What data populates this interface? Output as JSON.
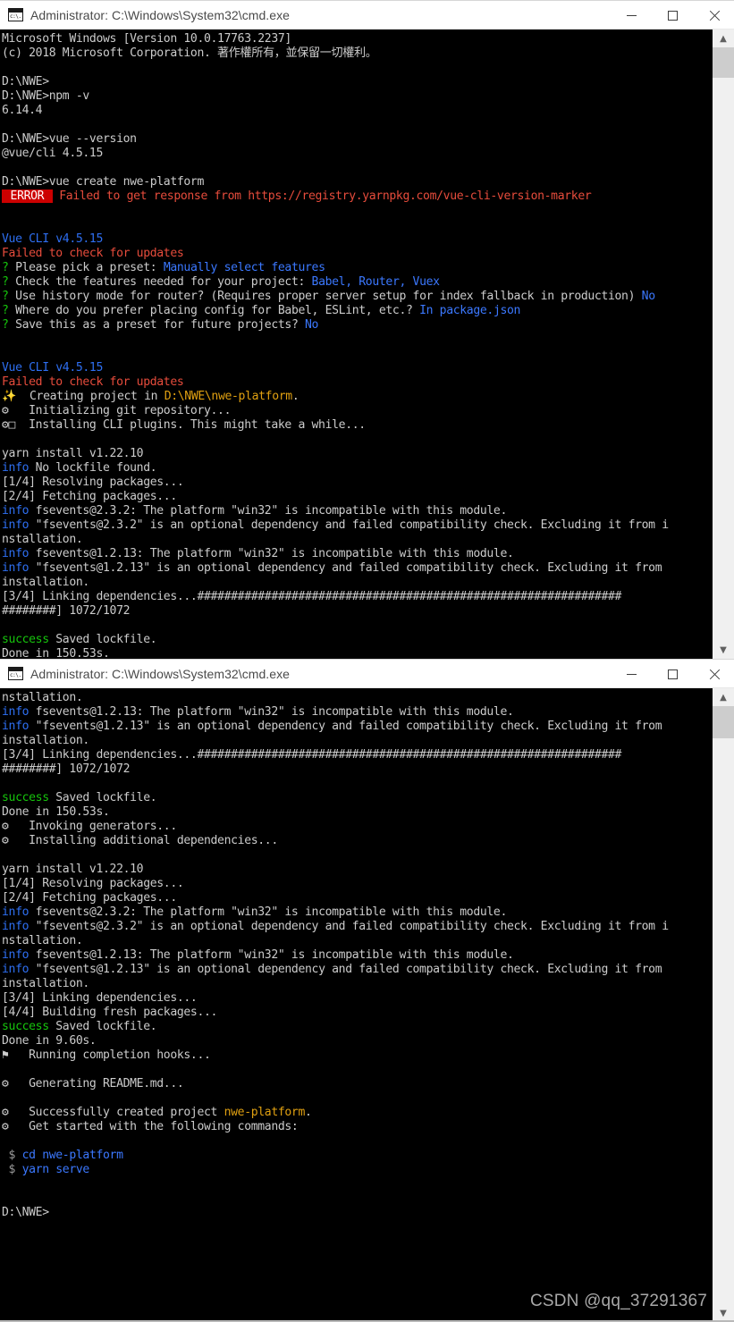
{
  "window1": {
    "title": "Administrator: C:\\Windows\\System32\\cmd.exe",
    "icon": "cmd-console-icon",
    "buttons": {
      "minimize": "—",
      "maximize": "☐",
      "close": "✕"
    },
    "lines": [
      [
        {
          "t": "Microsoft Windows [Version 10.0.17763.2237]",
          "c": "c-white"
        }
      ],
      [
        {
          "t": "(c) 2018 Microsoft Corporation. 著作權所有，並保留一切權利。",
          "c": "c-white"
        }
      ],
      [
        {
          "t": "",
          "c": "c-white"
        }
      ],
      [
        {
          "t": "D:\\NWE>",
          "c": "c-white"
        }
      ],
      [
        {
          "t": "D:\\NWE>npm -v",
          "c": "c-white"
        }
      ],
      [
        {
          "t": "6.14.4",
          "c": "c-white"
        }
      ],
      [
        {
          "t": "",
          "c": "c-white"
        }
      ],
      [
        {
          "t": "D:\\NWE>vue --version",
          "c": "c-white"
        }
      ],
      [
        {
          "t": "@vue/cli 4.5.15",
          "c": "c-white"
        }
      ],
      [
        {
          "t": "",
          "c": "c-white"
        }
      ],
      [
        {
          "t": "D:\\NWE>vue create nwe-platform",
          "c": "c-white"
        }
      ],
      [
        {
          "t": " ERROR ",
          "c": "c-redbg"
        },
        {
          "t": " Failed to get response from https://registry.yarnpkg.com/vue-cli-version-marker",
          "c": "c-red"
        }
      ],
      [
        {
          "t": "",
          "c": "c-white"
        }
      ],
      [
        {
          "t": "",
          "c": "c-white"
        }
      ],
      [
        {
          "t": "Vue CLI v4.5.15",
          "c": "c-blue"
        }
      ],
      [
        {
          "t": "Failed to check for updates",
          "c": "c-red"
        }
      ],
      [
        {
          "t": "?",
          "c": "c-green"
        },
        {
          "t": " Please pick a preset: ",
          "c": "c-white"
        },
        {
          "t": "Manually select features",
          "c": "c-cyan"
        }
      ],
      [
        {
          "t": "?",
          "c": "c-green"
        },
        {
          "t": " Check the features needed for your project: ",
          "c": "c-white"
        },
        {
          "t": "Babel, Router, Vuex",
          "c": "c-cyan"
        }
      ],
      [
        {
          "t": "?",
          "c": "c-green"
        },
        {
          "t": " Use history mode for router? (Requires proper server setup for index fallback in production) ",
          "c": "c-white"
        },
        {
          "t": "No",
          "c": "c-cyan"
        }
      ],
      [
        {
          "t": "?",
          "c": "c-green"
        },
        {
          "t": " Where do you prefer placing config for Babel, ESLint, etc.? ",
          "c": "c-white"
        },
        {
          "t": "In package.json",
          "c": "c-cyan"
        }
      ],
      [
        {
          "t": "?",
          "c": "c-green"
        },
        {
          "t": " Save this as a preset for future projects? ",
          "c": "c-white"
        },
        {
          "t": "No",
          "c": "c-cyan"
        }
      ],
      [
        {
          "t": "",
          "c": "c-white"
        }
      ],
      [
        {
          "t": "",
          "c": "c-white"
        }
      ],
      [
        {
          "t": "Vue CLI v4.5.15",
          "c": "c-blue"
        }
      ],
      [
        {
          "t": "Failed to check for updates",
          "c": "c-red"
        }
      ],
      [
        {
          "t": "✨  Creating project in ",
          "c": "c-white"
        },
        {
          "t": "D:\\NWE\\nwe-platform",
          "c": "c-yellow"
        },
        {
          "t": ".",
          "c": "c-white"
        }
      ],
      [
        {
          "t": "⚙   Initializing git repository...",
          "c": "c-white"
        }
      ],
      [
        {
          "t": "⚙□  Installing CLI plugins. This might take a while...",
          "c": "c-white"
        }
      ],
      [
        {
          "t": "",
          "c": "c-white"
        }
      ],
      [
        {
          "t": "yarn install v1.22.10",
          "c": "c-white"
        }
      ],
      [
        {
          "t": "info",
          "c": "c-blue"
        },
        {
          "t": " No lockfile found.",
          "c": "c-white"
        }
      ],
      [
        {
          "t": "[1/4] Resolving packages...",
          "c": "c-white"
        }
      ],
      [
        {
          "t": "[2/4] Fetching packages...",
          "c": "c-white"
        }
      ],
      [
        {
          "t": "info",
          "c": "c-blue"
        },
        {
          "t": " fsevents@2.3.2: The platform \"win32\" is incompatible with this module.",
          "c": "c-white"
        }
      ],
      [
        {
          "t": "info",
          "c": "c-blue"
        },
        {
          "t": " \"fsevents@2.3.2\" is an optional dependency and failed compatibility check. Excluding it from i",
          "c": "c-white"
        }
      ],
      [
        {
          "t": "nstallation.",
          "c": "c-white"
        }
      ],
      [
        {
          "t": "info",
          "c": "c-blue"
        },
        {
          "t": " fsevents@1.2.13: The platform \"win32\" is incompatible with this module.",
          "c": "c-white"
        }
      ],
      [
        {
          "t": "info",
          "c": "c-blue"
        },
        {
          "t": " \"fsevents@1.2.13\" is an optional dependency and failed compatibility check. Excluding it from",
          "c": "c-white"
        }
      ],
      [
        {
          "t": "installation.",
          "c": "c-white"
        }
      ],
      [
        {
          "t": "[3/4] Linking dependencies...###############################################################",
          "c": "c-white"
        }
      ],
      [
        {
          "t": "########] 1072/1072",
          "c": "c-white"
        }
      ],
      [
        {
          "t": "",
          "c": "c-white"
        }
      ],
      [
        {
          "t": "success",
          "c": "c-green"
        },
        {
          "t": " Saved lockfile.",
          "c": "c-white"
        }
      ],
      [
        {
          "t": "Done in 150.53s.",
          "c": "c-white"
        }
      ]
    ]
  },
  "window2": {
    "title": "Administrator: C:\\Windows\\System32\\cmd.exe",
    "icon": "cmd-console-icon",
    "buttons": {
      "minimize": "—",
      "maximize": "☐",
      "close": "✕"
    },
    "lines": [
      [
        {
          "t": "nstallation.",
          "c": "c-white"
        }
      ],
      [
        {
          "t": "info",
          "c": "c-blue"
        },
        {
          "t": " fsevents@1.2.13: The platform \"win32\" is incompatible with this module.",
          "c": "c-white"
        }
      ],
      [
        {
          "t": "info",
          "c": "c-blue"
        },
        {
          "t": " \"fsevents@1.2.13\" is an optional dependency and failed compatibility check. Excluding it from",
          "c": "c-white"
        }
      ],
      [
        {
          "t": "installation.",
          "c": "c-white"
        }
      ],
      [
        {
          "t": "[3/4] Linking dependencies...###############################################################",
          "c": "c-white"
        }
      ],
      [
        {
          "t": "########] 1072/1072",
          "c": "c-white"
        }
      ],
      [
        {
          "t": "",
          "c": "c-white"
        }
      ],
      [
        {
          "t": "success",
          "c": "c-green"
        },
        {
          "t": " Saved lockfile.",
          "c": "c-white"
        }
      ],
      [
        {
          "t": "Done in 150.53s.",
          "c": "c-white"
        }
      ],
      [
        {
          "t": "⚙   Invoking generators...",
          "c": "c-white"
        }
      ],
      [
        {
          "t": "⚙   Installing additional dependencies...",
          "c": "c-white"
        }
      ],
      [
        {
          "t": "",
          "c": "c-white"
        }
      ],
      [
        {
          "t": "yarn install v1.22.10",
          "c": "c-white"
        }
      ],
      [
        {
          "t": "[1/4] Resolving packages...",
          "c": "c-white"
        }
      ],
      [
        {
          "t": "[2/4] Fetching packages...",
          "c": "c-white"
        }
      ],
      [
        {
          "t": "info",
          "c": "c-blue"
        },
        {
          "t": " fsevents@2.3.2: The platform \"win32\" is incompatible with this module.",
          "c": "c-white"
        }
      ],
      [
        {
          "t": "info",
          "c": "c-blue"
        },
        {
          "t": " \"fsevents@2.3.2\" is an optional dependency and failed compatibility check. Excluding it from i",
          "c": "c-white"
        }
      ],
      [
        {
          "t": "nstallation.",
          "c": "c-white"
        }
      ],
      [
        {
          "t": "info",
          "c": "c-blue"
        },
        {
          "t": " fsevents@1.2.13: The platform \"win32\" is incompatible with this module.",
          "c": "c-white"
        }
      ],
      [
        {
          "t": "info",
          "c": "c-blue"
        },
        {
          "t": " \"fsevents@1.2.13\" is an optional dependency and failed compatibility check. Excluding it from",
          "c": "c-white"
        }
      ],
      [
        {
          "t": "installation.",
          "c": "c-white"
        }
      ],
      [
        {
          "t": "[3/4] Linking dependencies...",
          "c": "c-white"
        }
      ],
      [
        {
          "t": "[4/4] Building fresh packages...",
          "c": "c-white"
        }
      ],
      [
        {
          "t": "success",
          "c": "c-green"
        },
        {
          "t": " Saved lockfile.",
          "c": "c-white"
        }
      ],
      [
        {
          "t": "Done in 9.60s.",
          "c": "c-white"
        }
      ],
      [
        {
          "t": "⚑   Running completion hooks...",
          "c": "c-white"
        }
      ],
      [
        {
          "t": "",
          "c": "c-white"
        }
      ],
      [
        {
          "t": "⚙   Generating README.md...",
          "c": "c-white"
        }
      ],
      [
        {
          "t": "",
          "c": "c-white"
        }
      ],
      [
        {
          "t": "⚙   Successfully created project ",
          "c": "c-white"
        },
        {
          "t": "nwe-platform",
          "c": "c-yellow"
        },
        {
          "t": ".",
          "c": "c-white"
        }
      ],
      [
        {
          "t": "⚙   Get started with the following commands:",
          "c": "c-white"
        }
      ],
      [
        {
          "t": "",
          "c": "c-white"
        }
      ],
      [
        {
          "t": " $",
          "c": "c-gray"
        },
        {
          "t": " cd nwe-platform",
          "c": "c-cyan"
        }
      ],
      [
        {
          "t": " $",
          "c": "c-gray"
        },
        {
          "t": " yarn serve",
          "c": "c-cyan"
        }
      ],
      [
        {
          "t": "",
          "c": "c-white"
        }
      ],
      [
        {
          "t": "",
          "c": "c-white"
        }
      ],
      [
        {
          "t": "D:\\NWE>",
          "c": "c-white"
        }
      ]
    ]
  },
  "watermark": "CSDN @qq_37291367"
}
